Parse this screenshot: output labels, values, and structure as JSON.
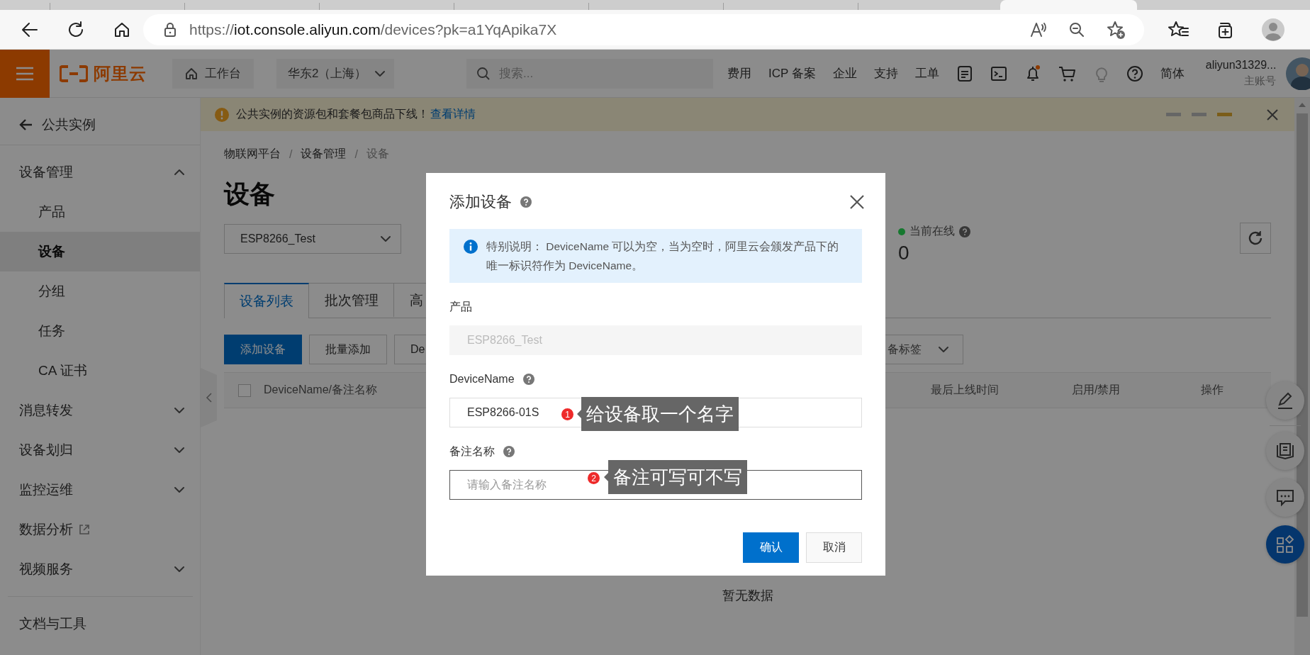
{
  "browser": {
    "url_scheme": "https://",
    "url_host": "iot.console.aliyun.com",
    "url_path": "/devices?pk=a1YqApika7X"
  },
  "header": {
    "logo": "阿里云",
    "workbench": "工作台",
    "region": "华东2（上海）",
    "search_placeholder": "搜索...",
    "nav": [
      "费用",
      "ICP 备案",
      "企业",
      "支持",
      "工单"
    ],
    "language": "简体",
    "account": "aliyun31329...",
    "account_role": "主账号"
  },
  "sidebar": {
    "back": "公共实例",
    "items": [
      {
        "label": "设备管理",
        "kind": "group",
        "expanded": true,
        "children": [
          {
            "label": "产品",
            "selected": false
          },
          {
            "label": "设备",
            "selected": true
          },
          {
            "label": "分组",
            "selected": false
          },
          {
            "label": "任务",
            "selected": false
          },
          {
            "label": "CA 证书",
            "selected": false
          }
        ]
      },
      {
        "label": "消息转发",
        "kind": "group",
        "expanded": false
      },
      {
        "label": "设备划归",
        "kind": "group",
        "expanded": false
      },
      {
        "label": "监控运维",
        "kind": "group",
        "expanded": false
      },
      {
        "label": "数据分析",
        "kind": "external"
      },
      {
        "label": "视频服务",
        "kind": "group",
        "expanded": false
      }
    ],
    "footer": "文档与工具"
  },
  "banner": {
    "text": "公共实例的资源包和套餐包商品下线！",
    "link": "查看详情",
    "pages": [
      {
        "selected": false
      },
      {
        "selected": false
      },
      {
        "selected": true
      }
    ]
  },
  "breadcrumb": [
    "物联网平台",
    "设备管理",
    "设备"
  ],
  "breadcrumb_separator": "/",
  "page_title": "设备",
  "product_select": "ESP8266_Test",
  "stats": [
    {
      "label": "当前在线",
      "value": "0",
      "color": "#16782f"
    }
  ],
  "tabs": [
    {
      "label": "设备列表",
      "selected": true
    },
    {
      "label": "批次管理",
      "selected": false
    },
    {
      "label": "高",
      "selected": false
    }
  ],
  "toolbar": {
    "buttons": [
      {
        "label": "添加设备",
        "kind": "primary"
      },
      {
        "label": "批量添加",
        "kind": "normal"
      },
      {
        "label": "De",
        "kind": "normal"
      }
    ],
    "tag_select": "备标签"
  },
  "table": {
    "select_all_checked": false,
    "columns": [
      "DeviceName/备注名称",
      "最后上线时间",
      "启用/禁用",
      "操作"
    ],
    "empty_text": "暂无数据"
  },
  "modal": {
    "title": "添加设备",
    "notice": "特别说明： DeviceName 可以为空，当为空时，阿里云会颁发产品下的唯一标识符作为 DeviceName。",
    "fields": [
      {
        "label": "产品",
        "help": false,
        "value": "ESP8266_Test",
        "disabled": true,
        "focused": false
      },
      {
        "label": "DeviceName",
        "help": true,
        "value": "ESP8266-01S",
        "disabled": false,
        "focused": false
      },
      {
        "label": "备注名称",
        "help": true,
        "placeholder": "请输入备注名称",
        "disabled": false,
        "focused": true
      }
    ],
    "buttons": [
      {
        "label": "确认",
        "kind": "primary"
      },
      {
        "label": "取消",
        "kind": "normal"
      }
    ]
  },
  "annotations": [
    {
      "number": "1",
      "text": "给设备取一个名字"
    },
    {
      "number": "2",
      "text": "备注可写可不写"
    }
  ]
}
